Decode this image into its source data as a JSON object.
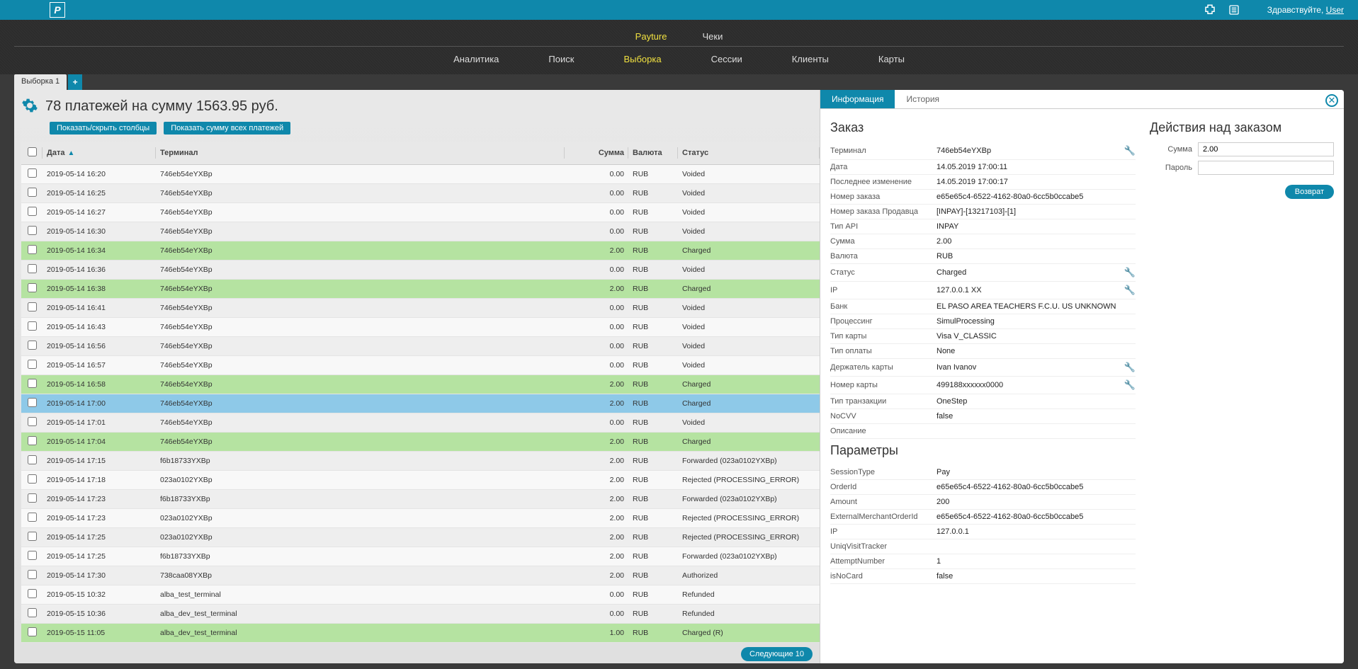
{
  "header": {
    "greeting_prefix": "Здравствуйте, ",
    "user": "User"
  },
  "main_tabs": [
    "Payture",
    "Чеки"
  ],
  "main_tab_active": 0,
  "sub_tabs": [
    "Аналитика",
    "Поиск",
    "Выборка",
    "Сессии",
    "Клиенты",
    "Карты"
  ],
  "sub_tab_active": 2,
  "page_tab": "Выборка 1",
  "title": "78 платежей на сумму 1563.95 руб.",
  "buttons": {
    "toggle_cols": "Показать/скрыть столбцы",
    "show_sum": "Показать сумму всех платежей",
    "next": "Следующие 10"
  },
  "columns": {
    "date": "Дата",
    "terminal": "Терминал",
    "amount": "Сумма",
    "currency": "Валюта",
    "status": "Статус"
  },
  "rows": [
    {
      "date": "2019-05-14 16:20",
      "term": "746eb54eYXBp",
      "amt": "0.00",
      "cur": "RUB",
      "stat": "Voided",
      "cls": ""
    },
    {
      "date": "2019-05-14 16:25",
      "term": "746eb54eYXBp",
      "amt": "0.00",
      "cur": "RUB",
      "stat": "Voided",
      "cls": ""
    },
    {
      "date": "2019-05-14 16:27",
      "term": "746eb54eYXBp",
      "amt": "0.00",
      "cur": "RUB",
      "stat": "Voided",
      "cls": ""
    },
    {
      "date": "2019-05-14 16:30",
      "term": "746eb54eYXBp",
      "amt": "0.00",
      "cur": "RUB",
      "stat": "Voided",
      "cls": ""
    },
    {
      "date": "2019-05-14 16:34",
      "term": "746eb54eYXBp",
      "amt": "2.00",
      "cur": "RUB",
      "stat": "Charged",
      "cls": "green"
    },
    {
      "date": "2019-05-14 16:36",
      "term": "746eb54eYXBp",
      "amt": "0.00",
      "cur": "RUB",
      "stat": "Voided",
      "cls": ""
    },
    {
      "date": "2019-05-14 16:38",
      "term": "746eb54eYXBp",
      "amt": "2.00",
      "cur": "RUB",
      "stat": "Charged",
      "cls": "green"
    },
    {
      "date": "2019-05-14 16:41",
      "term": "746eb54eYXBp",
      "amt": "0.00",
      "cur": "RUB",
      "stat": "Voided",
      "cls": ""
    },
    {
      "date": "2019-05-14 16:43",
      "term": "746eb54eYXBp",
      "amt": "0.00",
      "cur": "RUB",
      "stat": "Voided",
      "cls": ""
    },
    {
      "date": "2019-05-14 16:56",
      "term": "746eb54eYXBp",
      "amt": "0.00",
      "cur": "RUB",
      "stat": "Voided",
      "cls": ""
    },
    {
      "date": "2019-05-14 16:57",
      "term": "746eb54eYXBp",
      "amt": "0.00",
      "cur": "RUB",
      "stat": "Voided",
      "cls": ""
    },
    {
      "date": "2019-05-14 16:58",
      "term": "746eb54eYXBp",
      "amt": "2.00",
      "cur": "RUB",
      "stat": "Charged",
      "cls": "green"
    },
    {
      "date": "2019-05-14 17:00",
      "term": "746eb54eYXBp",
      "amt": "2.00",
      "cur": "RUB",
      "stat": "Charged",
      "cls": "selected"
    },
    {
      "date": "2019-05-14 17:01",
      "term": "746eb54eYXBp",
      "amt": "0.00",
      "cur": "RUB",
      "stat": "Voided",
      "cls": ""
    },
    {
      "date": "2019-05-14 17:04",
      "term": "746eb54eYXBp",
      "amt": "2.00",
      "cur": "RUB",
      "stat": "Charged",
      "cls": "green"
    },
    {
      "date": "2019-05-14 17:15",
      "term": "f6b18733YXBp",
      "amt": "2.00",
      "cur": "RUB",
      "stat": "Forwarded (023a0102YXBp)",
      "cls": ""
    },
    {
      "date": "2019-05-14 17:18",
      "term": "023a0102YXBp",
      "amt": "2.00",
      "cur": "RUB",
      "stat": "Rejected (PROCESSING_ERROR)",
      "cls": ""
    },
    {
      "date": "2019-05-14 17:23",
      "term": "f6b18733YXBp",
      "amt": "2.00",
      "cur": "RUB",
      "stat": "Forwarded (023a0102YXBp)",
      "cls": ""
    },
    {
      "date": "2019-05-14 17:23",
      "term": "023a0102YXBp",
      "amt": "2.00",
      "cur": "RUB",
      "stat": "Rejected (PROCESSING_ERROR)",
      "cls": ""
    },
    {
      "date": "2019-05-14 17:25",
      "term": "023a0102YXBp",
      "amt": "2.00",
      "cur": "RUB",
      "stat": "Rejected (PROCESSING_ERROR)",
      "cls": ""
    },
    {
      "date": "2019-05-14 17:25",
      "term": "f6b18733YXBp",
      "amt": "2.00",
      "cur": "RUB",
      "stat": "Forwarded (023a0102YXBp)",
      "cls": ""
    },
    {
      "date": "2019-05-14 17:30",
      "term": "738caa08YXBp",
      "amt": "2.00",
      "cur": "RUB",
      "stat": "Authorized",
      "cls": ""
    },
    {
      "date": "2019-05-15 10:32",
      "term": "alba_test_terminal",
      "amt": "0.00",
      "cur": "RUB",
      "stat": "Refunded",
      "cls": ""
    },
    {
      "date": "2019-05-15 10:36",
      "term": "alba_dev_test_terminal",
      "amt": "0.00",
      "cur": "RUB",
      "stat": "Refunded",
      "cls": ""
    },
    {
      "date": "2019-05-15 11:05",
      "term": "alba_dev_test_terminal",
      "amt": "1.00",
      "cur": "RUB",
      "stat": "Charged (R)",
      "cls": "green"
    }
  ],
  "detail": {
    "tabs": [
      "Информация",
      "История"
    ],
    "active_tab": 0,
    "order_heading": "Заказ",
    "params_heading": "Параметры",
    "order": [
      {
        "k": "Терминал",
        "v": "746eb54eYXBp",
        "tool": true
      },
      {
        "k": "Дата",
        "v": "14.05.2019 17:00:11"
      },
      {
        "k": "Последнее изменение",
        "v": "14.05.2019 17:00:17"
      },
      {
        "k": "Номер заказа",
        "v": "e65e65c4-6522-4162-80a0-6cc5b0ccabe5"
      },
      {
        "k": "Номер заказа Продавца",
        "v": "[INPAY]-[13217103]-[1]"
      },
      {
        "k": "Тип API",
        "v": "INPAY"
      },
      {
        "k": "Сумма",
        "v": "2.00"
      },
      {
        "k": "Валюта",
        "v": "RUB"
      },
      {
        "k": "Статус",
        "v": "Charged",
        "tool": true
      },
      {
        "k": "IP",
        "v": "127.0.0.1 XX",
        "tool": true
      },
      {
        "k": "Банк",
        "v": "EL PASO AREA TEACHERS F.C.U. US UNKNOWN"
      },
      {
        "k": "Процессинг",
        "v": "SimulProcessing"
      },
      {
        "k": "Тип карты",
        "v": "Visa V_CLASSIC"
      },
      {
        "k": "Тип оплаты",
        "v": "None"
      },
      {
        "k": "Держатель карты",
        "v": "Ivan Ivanov",
        "tool": true
      },
      {
        "k": "Номер карты",
        "v": "499188xxxxxx0000",
        "tool": true
      },
      {
        "k": "Тип транзакции",
        "v": "OneStep"
      },
      {
        "k": "NoCVV",
        "v": "false"
      },
      {
        "k": "Описание",
        "v": ""
      }
    ],
    "params": [
      {
        "k": "SessionType",
        "v": "Pay"
      },
      {
        "k": "OrderId",
        "v": "e65e65c4-6522-4162-80a0-6cc5b0ccabe5"
      },
      {
        "k": "Amount",
        "v": "200"
      },
      {
        "k": "ExternalMerchantOrderId",
        "v": "e65e65c4-6522-4162-80a0-6cc5b0ccabe5"
      },
      {
        "k": "IP",
        "v": "127.0.0.1"
      },
      {
        "k": "UniqVisitTracker",
        "v": ""
      },
      {
        "k": "AttemptNumber",
        "v": "1"
      },
      {
        "k": "isNoCard",
        "v": "false"
      }
    ],
    "actions": {
      "heading": "Действия над заказом",
      "amount_label": "Сумма",
      "amount_value": "2.00",
      "password_label": "Пароль",
      "password_value": "",
      "return_btn": "Возврат"
    }
  }
}
